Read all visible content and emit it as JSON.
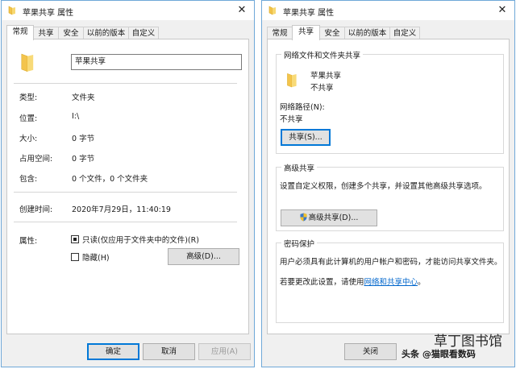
{
  "left_window": {
    "title": "苹果共享 属性",
    "tabs": [
      "常规",
      "共享",
      "安全",
      "以前的版本",
      "自定义"
    ],
    "name_value": "苹果共享",
    "rows": {
      "type_label": "类型:",
      "type_value": "文件夹",
      "location_label": "位置:",
      "location_value": "I:\\",
      "size_label": "大小:",
      "size_value": "0 字节",
      "disk_label": "占用空间:",
      "disk_value": "0 字节",
      "contains_label": "包含:",
      "contains_value": "0 个文件，0 个文件夹",
      "created_label": "创建时间:",
      "created_value": "2020年7月29日，11:40:19",
      "attributes_label": "属性:"
    },
    "readonly_label": "只读(仅应用于文件夹中的文件)(R)",
    "hidden_label": "隐藏(H)",
    "advanced_button": "高级(D)...",
    "ok_button": "确定",
    "cancel_button": "取消",
    "apply_button": "应用(A)"
  },
  "right_window": {
    "title": "苹果共享 属性",
    "tabs": [
      "常规",
      "共享",
      "安全",
      "以前的版本",
      "自定义"
    ],
    "network_group": "网络文件和文件夹共享",
    "folder_name": "苹果共享",
    "share_state": "不共享",
    "network_path_label": "网络路径(N):",
    "network_path_value": "不共享",
    "share_button": "共享(S)...",
    "advanced_group": "高级共享",
    "advanced_desc": "设置自定义权限，创建多个共享，并设置其他高级共享选项。",
    "advanced_button": "高级共享(D)...",
    "password_group": "密码保护",
    "password_desc": "用户必须具有此计算机的用户帐户和密码，才能访问共享文件夹。",
    "password_change_prefix": "若要更改此设置，请使用",
    "password_link": "网络和共享中心",
    "password_change_suffix": "。",
    "close_button": "关闭"
  },
  "watermark": {
    "logo_text": "草丁图书馆",
    "caption": "头条 @猫眼看数码"
  },
  "colors": {
    "window_border": "#6fa8d8",
    "folder_yellow": "#f3c44c",
    "link_blue": "#0066cc",
    "primary_button_border": "#0078d7"
  }
}
